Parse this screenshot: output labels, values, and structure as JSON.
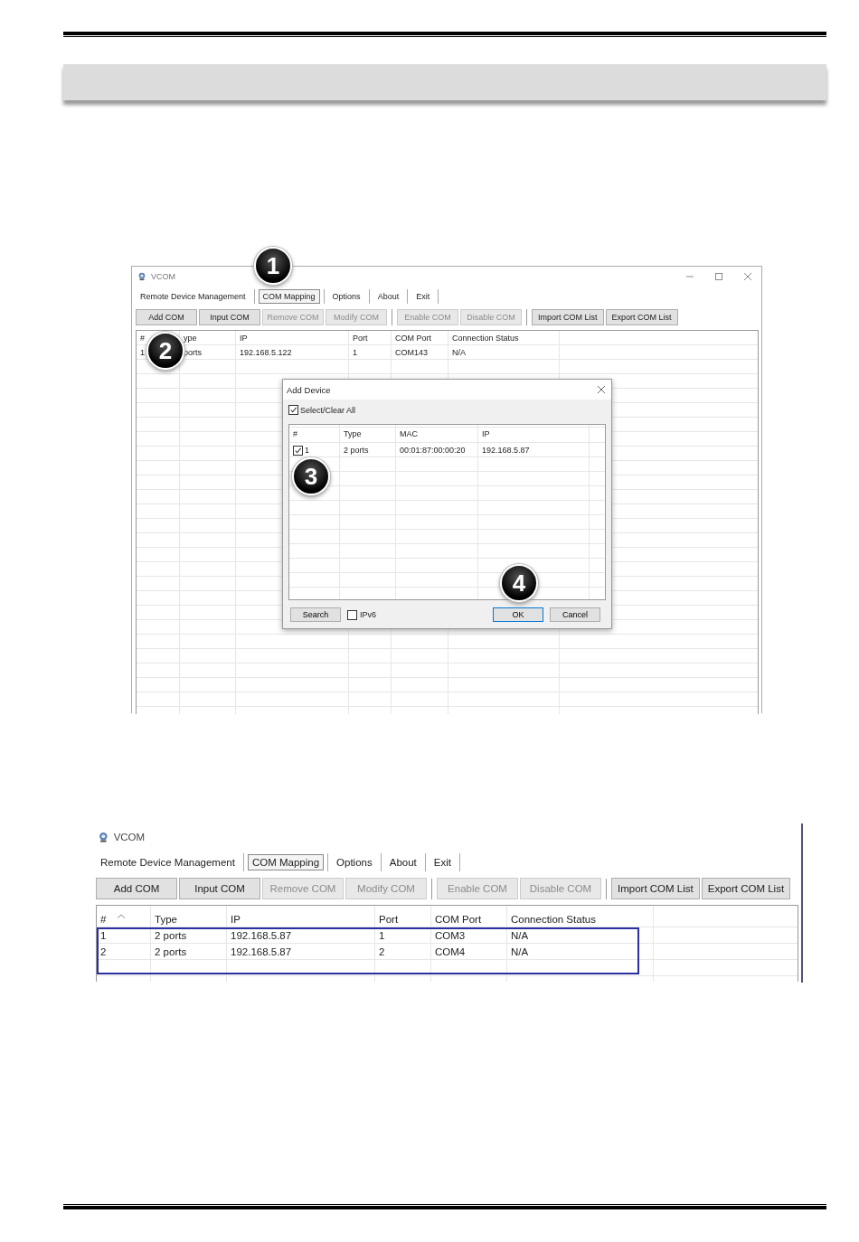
{
  "screenshots": [
    {
      "window": {
        "title": "VCOM",
        "controls": true
      },
      "menu": [
        {
          "label": "Remote Device Management",
          "selected": false
        },
        {
          "label": "COM Mapping",
          "selected": true
        },
        {
          "label": "Options",
          "selected": false
        },
        {
          "label": "About",
          "selected": false
        },
        {
          "label": "Exit",
          "selected": false
        }
      ],
      "toolbar": [
        [
          {
            "label": "Add COM",
            "disabled": false
          },
          {
            "label": "Input COM",
            "disabled": false
          },
          {
            "label": "Remove COM",
            "disabled": true
          },
          {
            "label": "Modify COM",
            "disabled": true
          }
        ],
        [
          {
            "label": "Enable COM",
            "disabled": true
          },
          {
            "label": "Disable COM",
            "disabled": true
          }
        ],
        [
          {
            "label": "Import COM List",
            "disabled": false
          },
          {
            "label": "Export COM List",
            "disabled": false
          }
        ]
      ],
      "table": {
        "columns": [
          {
            "label": "#"
          },
          {
            "label": "ype"
          },
          {
            "label": "IP"
          },
          {
            "label": "Port"
          },
          {
            "label": "COM Port"
          },
          {
            "label": "Connection Status"
          }
        ],
        "rows": [
          [
            "1",
            "ports",
            "192.168.5.122",
            "1",
            "COM143",
            "N/A"
          ]
        ]
      },
      "callouts": [
        "1",
        "2"
      ],
      "dialog": {
        "title": "Add Device",
        "select_all": {
          "label": "Select/Clear All",
          "checked": true
        },
        "columns": [
          "#",
          "Type",
          "MAC",
          "IP"
        ],
        "rows": [
          {
            "checked": true,
            "cells": [
              "1",
              "2 ports",
              "00:01:87:00:00:20",
              "192.168.5.87"
            ]
          }
        ],
        "search_button": "Search",
        "ipv6": {
          "label": "IPv6",
          "checked": false
        },
        "buttons": [
          {
            "label": "OK",
            "default": true
          },
          {
            "label": "Cancel",
            "default": false
          }
        ],
        "callouts": [
          "3",
          "4"
        ]
      }
    },
    {
      "window": {
        "title": "VCOM"
      },
      "menu": [
        {
          "label": "Remote Device Management",
          "selected": false
        },
        {
          "label": "COM Mapping",
          "selected": true
        },
        {
          "label": "Options",
          "selected": false
        },
        {
          "label": "About",
          "selected": false
        },
        {
          "label": "Exit",
          "selected": false
        }
      ],
      "toolbar": [
        [
          {
            "label": "Add COM",
            "disabled": false
          },
          {
            "label": "Input COM",
            "disabled": false
          },
          {
            "label": "Remove COM",
            "disabled": true
          },
          {
            "label": "Modify COM",
            "disabled": true
          }
        ],
        [
          {
            "label": "Enable COM",
            "disabled": true
          },
          {
            "label": "Disable COM",
            "disabled": true
          }
        ],
        [
          {
            "label": "Import COM List",
            "disabled": false
          },
          {
            "label": "Export COM List",
            "disabled": false
          }
        ]
      ],
      "table": {
        "columns": [
          {
            "label": "#",
            "sorted": true
          },
          {
            "label": "Type",
            "sorted": false
          },
          {
            "label": "IP",
            "sorted": false
          },
          {
            "label": "Port",
            "sorted": false
          },
          {
            "label": "COM Port",
            "sorted": false
          },
          {
            "label": "Connection Status",
            "sorted": false
          }
        ],
        "rows": [
          [
            "1",
            "2 ports",
            "192.168.5.87",
            "1",
            "COM3",
            "N/A"
          ],
          [
            "2",
            "2 ports",
            "192.168.5.87",
            "2",
            "COM4",
            "N/A"
          ]
        ],
        "highlighted": true
      }
    }
  ]
}
